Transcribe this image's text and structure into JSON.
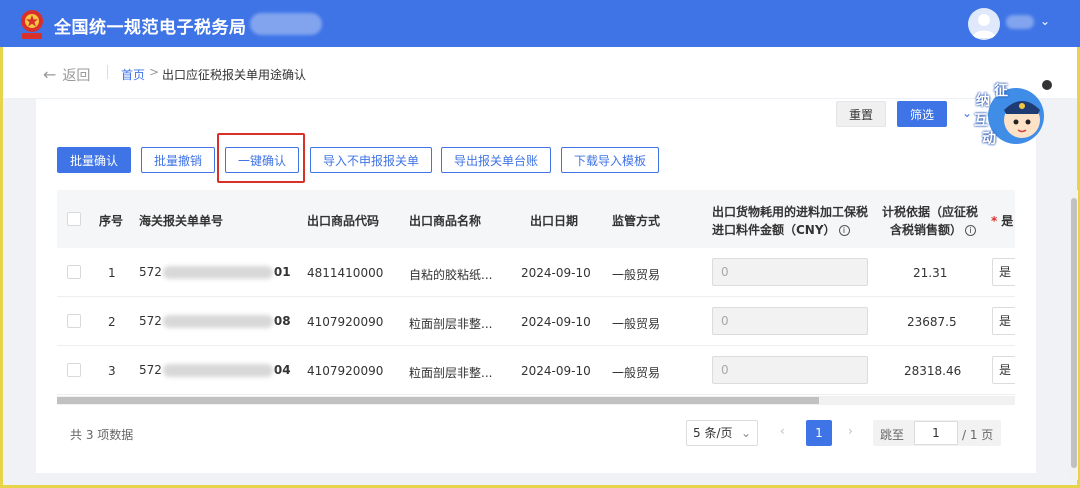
{
  "header": {
    "title": "全国统一规范电子税务局"
  },
  "breadcrumb": {
    "back": "返回",
    "home": "首页",
    "separator": ">",
    "current": "出口应征税报关单用途确认"
  },
  "filter_buttons": {
    "reset": "重置",
    "filter": "筛选"
  },
  "actions": {
    "batch_confirm": "批量确认",
    "batch_revoke": "批量撤销",
    "one_click_confirm": "一键确认",
    "import_no_declare": "导入不申报报关单",
    "export_ledger": "导出报关单台账",
    "download_template": "下载导入模板"
  },
  "mascot": {
    "chars": [
      "征",
      "纳",
      "互",
      "动"
    ]
  },
  "table": {
    "headers": {
      "seq": "序号",
      "declaration_no": "海关报关单单号",
      "product_code": "出口商品代码",
      "product_name": "出口商品名称",
      "export_date": "出口日期",
      "supervision": "监管方式",
      "bonded_amount_l1": "出口货物耗用的进料加工保税",
      "bonded_amount_l2": "进口料件金额（CNY）",
      "tax_basis_l1": "计税依据（应征税",
      "tax_basis_l2": "含税销售额）",
      "required_mark": "*",
      "yes_col": "是"
    },
    "rows": [
      {
        "seq": "1",
        "no_prefix": "572",
        "no_suffix": "01",
        "code": "4811410000",
        "name": "自粘的胶粘纸...",
        "date": "2024-09-10",
        "mode": "一般贸易",
        "amount": "0",
        "basis": "21.31",
        "flag": "是"
      },
      {
        "seq": "2",
        "no_prefix": "572",
        "no_suffix": "08",
        "code": "4107920090",
        "name": "粒面剖层非整...",
        "date": "2024-09-10",
        "mode": "一般贸易",
        "amount": "0",
        "basis": "23687.5",
        "flag": "是"
      },
      {
        "seq": "3",
        "no_prefix": "572",
        "no_suffix": "04",
        "code": "4107920090",
        "name": "粒面剖层非整...",
        "date": "2024-09-10",
        "mode": "一般贸易",
        "amount": "0",
        "basis": "28318.46",
        "flag": "是"
      }
    ]
  },
  "pagination": {
    "total": "共 3 项数据",
    "page_size": "5 条/页",
    "current_page": "1",
    "jump_label": "跳至",
    "jump_value": "1",
    "total_pages": "/ 1 页"
  },
  "colors": {
    "brand_blue": "#3f74e6",
    "highlight_red": "#d9302b",
    "frame_yellow": "#e6d44a"
  }
}
